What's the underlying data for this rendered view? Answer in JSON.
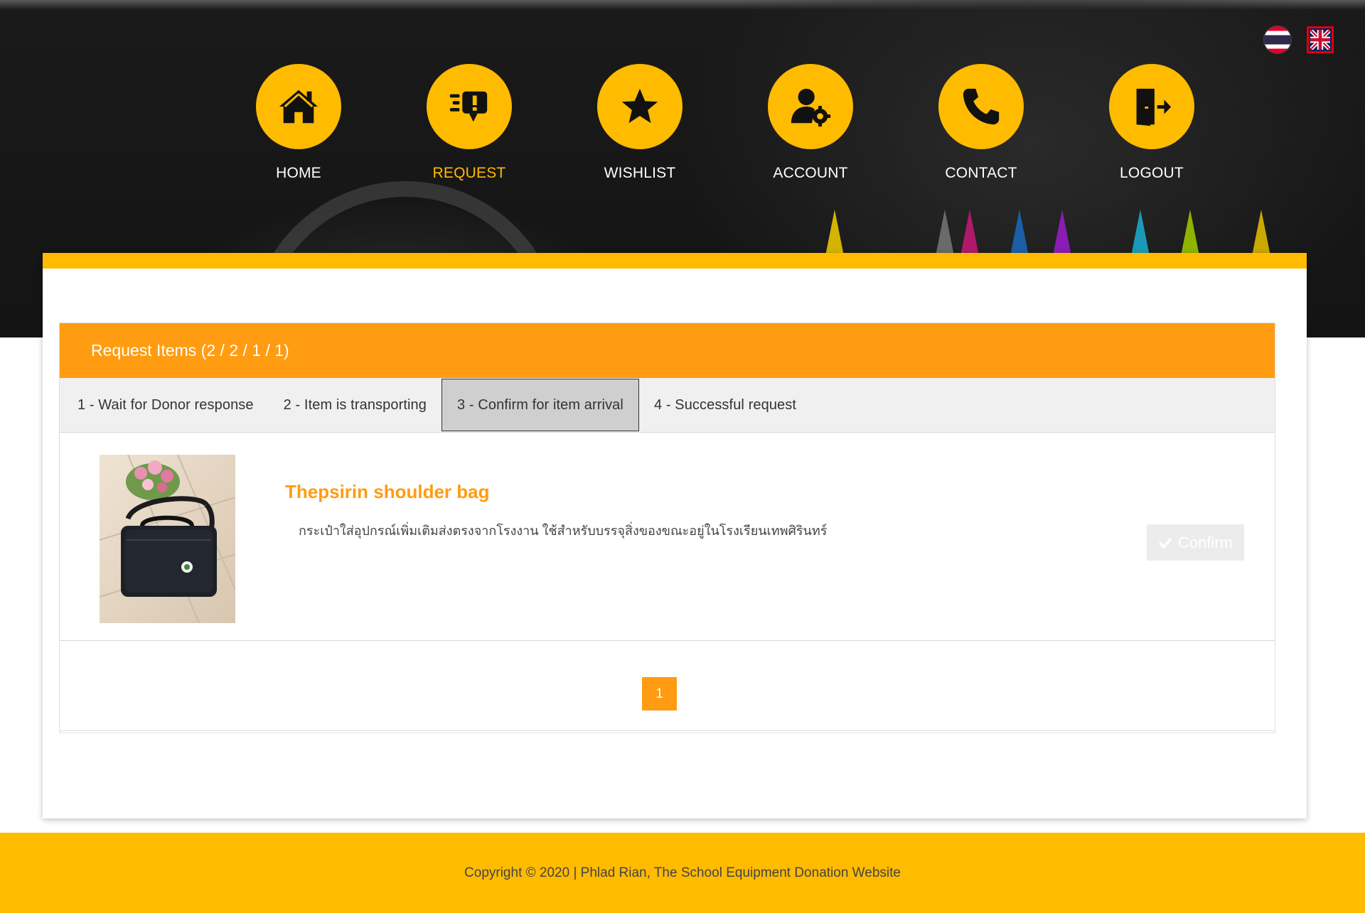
{
  "language": {
    "thai_flag": "thai-flag-icon",
    "english_flag": "uk-flag-icon"
  },
  "nav": {
    "items": [
      {
        "label": "HOME",
        "icon": "house-icon"
      },
      {
        "label": "REQUEST",
        "icon": "request-alert-icon"
      },
      {
        "label": "WISHLIST",
        "icon": "star-icon"
      },
      {
        "label": "ACCOUNT",
        "icon": "user-gear-icon"
      },
      {
        "label": "CONTACT",
        "icon": "phone-icon"
      },
      {
        "label": "LOGOUT",
        "icon": "door-exit-icon"
      }
    ],
    "active": "REQUEST",
    "accent": "#ffbb00"
  },
  "request_panel": {
    "title": "Request Items (2 / 2 / 1 / 1)",
    "tabs": [
      "1 - Wait for Donor response",
      "2 - Item is transporting",
      "3 - Confirm for item arrival",
      "4 - Successful request"
    ],
    "active_tab": "3 - Confirm for item arrival",
    "items": [
      {
        "title": "Thepsirin shoulder bag",
        "description": "กระเป๋าใส่อุปกรณ์เพิ่มเติมส่งตรงจากโรงงาน ใช้สำหรับบรรจุสิ่งของขณะอยู่ในโรงเรียนเทพศิรินทร์",
        "image": "shoulder-bag-photo",
        "confirm_label": "Confirm",
        "confirm_icon": "check-icon"
      }
    ],
    "header_color": "#ff9c11"
  },
  "pagination": {
    "current_page": "1"
  },
  "footer": {
    "copyright": "Copyright © 2020 | Phlad Rian, The School Equipment Donation Website"
  }
}
